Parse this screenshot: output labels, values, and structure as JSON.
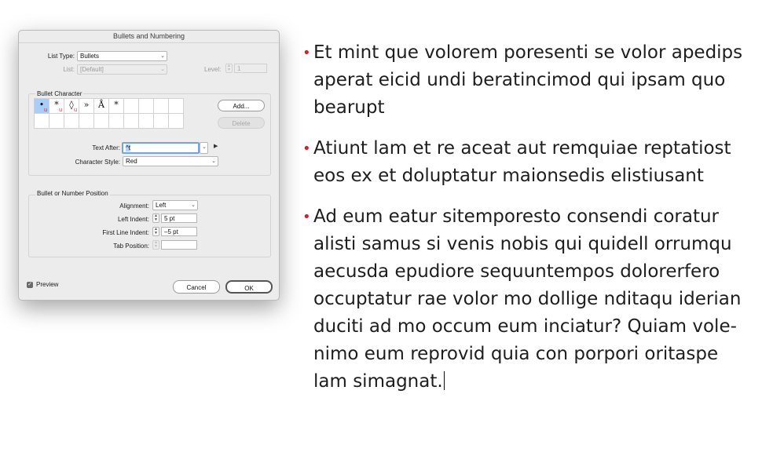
{
  "dialog": {
    "title": "Bullets and Numbering",
    "list_type": {
      "label": "List Type:",
      "value": "Bullets"
    },
    "list": {
      "label": "List:",
      "value": "[Default]"
    },
    "level": {
      "label": "Level:",
      "value": "1"
    },
    "bullet_character": {
      "title": "Bullet Character",
      "glyphs": [
        "•",
        "*",
        "◊",
        "»",
        "Å",
        "*"
      ],
      "red_u_marks": [
        "u",
        "u",
        "u"
      ],
      "add_button": "Add...",
      "delete_button": "Delete"
    },
    "text_after": {
      "label": "Text After:",
      "value": "^t"
    },
    "character_style": {
      "label": "Character Style:",
      "value": "Red"
    },
    "position": {
      "title": "Bullet or Number Position",
      "alignment": {
        "label": "Alignment:",
        "value": "Left"
      },
      "left_indent": {
        "label": "Left Indent:",
        "value": "5 pt"
      },
      "first_line_indent": {
        "label": "First Line Indent:",
        "value": "–5 pt"
      },
      "tab_position": {
        "label": "Tab Position:",
        "value": ""
      }
    },
    "preview": {
      "label": "Preview",
      "checked": true
    },
    "cancel_button": "Cancel",
    "ok_button": "OK"
  },
  "document": {
    "bullet_color": "#d3202f",
    "paragraphs": [
      {
        "lines": [
          "Et mint que volorem poresenti se volor apedips",
          "aperat eicid undi beratincimod qui ipsam quo",
          "bearupt"
        ]
      },
      {
        "lines": [
          "Atiunt lam et re aceat aut remquiae reptatiost",
          "eos ex et doluptatur maionsedis elistiusant"
        ]
      },
      {
        "lines": [
          "Ad eum eatur sitemporesto consendi coratur",
          "alisti samus si venis nobis qui quidell orrumqu",
          "aecusda epudiore sequuntempos dolorerfero",
          "occuptatur rae volor mo dollige nditaqu iderian",
          "duciti ad mo occum eum inciatur? Quiam vole-",
          "nimo eum reprovid quia con porpori oritaspe",
          "lam simagnat."
        ]
      }
    ]
  }
}
